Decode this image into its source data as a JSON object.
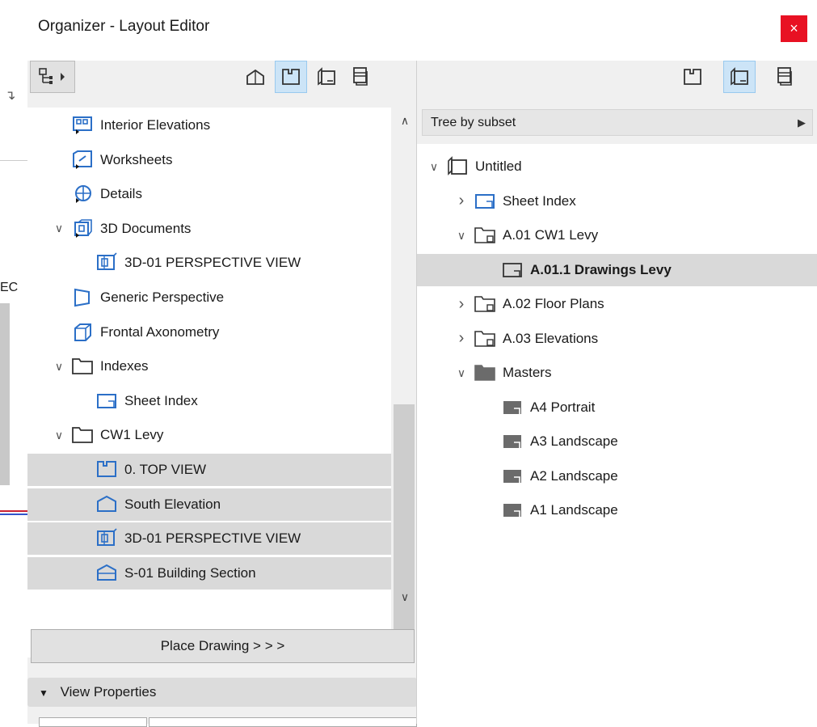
{
  "window": {
    "title": "Organizer - Layout Editor",
    "close_label": "×"
  },
  "left_strip": {
    "partial_label": "EC"
  },
  "left_panel": {
    "tree": [
      {
        "label": "Interior Elevations",
        "icon": "interior-elevations-icon",
        "chevron": "",
        "indent": 0
      },
      {
        "label": "Worksheets",
        "icon": "worksheets-icon",
        "chevron": "",
        "indent": 0
      },
      {
        "label": "Details",
        "icon": "details-icon",
        "chevron": "",
        "indent": 0
      },
      {
        "label": "3D Documents",
        "icon": "3d-documents-icon",
        "chevron": "v",
        "indent": 0
      },
      {
        "label": "3D-01 PERSPECTIVE VIEW",
        "icon": "3d-view-icon",
        "chevron": "",
        "indent": 1
      },
      {
        "label": "Generic Perspective",
        "icon": "perspective-icon",
        "chevron": "",
        "indent": 0
      },
      {
        "label": "Frontal Axonometry",
        "icon": "axonometry-icon",
        "chevron": "",
        "indent": 0
      },
      {
        "label": "Indexes",
        "icon": "folder-icon",
        "chevron": "v",
        "indent": 0
      },
      {
        "label": "Sheet Index",
        "icon": "sheet-index-icon",
        "chevron": "",
        "indent": 1
      },
      {
        "label": "CW1 Levy",
        "icon": "folder-icon",
        "chevron": "v",
        "indent": 0
      },
      {
        "label": "0. TOP VIEW",
        "icon": "floor-plan-icon",
        "chevron": "",
        "indent": 1,
        "selected": true
      },
      {
        "label": "South Elevation",
        "icon": "elevation-icon",
        "chevron": "",
        "indent": 1,
        "selected": true
      },
      {
        "label": "3D-01 PERSPECTIVE VIEW",
        "icon": "3d-view-icon",
        "chevron": "",
        "indent": 1,
        "selected": true
      },
      {
        "label": "S-01 Building Section",
        "icon": "section-icon",
        "chevron": "",
        "indent": 1,
        "selected": true
      }
    ],
    "place_button": "Place Drawing > > >",
    "view_properties": "View Properties"
  },
  "right_panel": {
    "subset_label": "Tree by subset",
    "tree": [
      {
        "label": "Untitled",
        "icon": "layout-book-icon",
        "chevron": "v",
        "indent": 0,
        "bold": false
      },
      {
        "label": "Sheet Index",
        "icon": "sheet-index-icon",
        "chevron": ">",
        "indent": 1,
        "bold": false
      },
      {
        "label": "A.01 CW1 Levy",
        "icon": "subset-folder-icon",
        "chevron": "v",
        "indent": 1,
        "bold": false
      },
      {
        "label": "A.01.1 Drawings Levy",
        "icon": "layout-icon",
        "chevron": "",
        "indent": 2,
        "bold": true,
        "selected": true
      },
      {
        "label": "A.02 Floor Plans",
        "icon": "subset-folder-icon",
        "chevron": ">",
        "indent": 1,
        "bold": false
      },
      {
        "label": "A.03 Elevations",
        "icon": "subset-folder-icon",
        "chevron": ">",
        "indent": 1,
        "bold": false
      },
      {
        "label": "Masters",
        "icon": "masters-folder-icon",
        "chevron": "v",
        "indent": 1,
        "bold": false
      },
      {
        "label": "A4 Portrait",
        "icon": "master-layout-icon",
        "chevron": "",
        "indent": 2,
        "bold": false
      },
      {
        "label": "A3 Landscape",
        "icon": "master-layout-icon",
        "chevron": "",
        "indent": 2,
        "bold": false
      },
      {
        "label": "A2 Landscape",
        "icon": "master-layout-icon",
        "chevron": "",
        "indent": 2,
        "bold": false
      },
      {
        "label": "A1 Landscape",
        "icon": "master-layout-icon",
        "chevron": "",
        "indent": 2,
        "bold": false
      }
    ]
  },
  "colors": {
    "accent": "#2b6fc7",
    "selection": "#d9d9d9",
    "active_tool": "#cce4f7",
    "close": "#e81123"
  }
}
